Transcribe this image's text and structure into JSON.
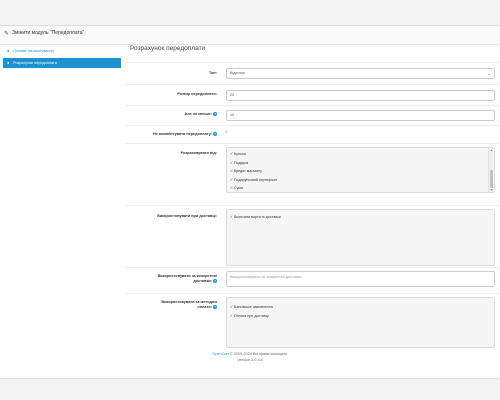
{
  "panel": {
    "title": "Змінити модуль \"Передоплата\""
  },
  "tabs": [
    {
      "label": "Основні налаштування",
      "icon": "circle-icon"
    },
    {
      "label": "Розрахунок передоплати",
      "icon": "circle-icon"
    }
  ],
  "content": {
    "title": "Розрахунок передоплати"
  },
  "fields": {
    "type": {
      "label": "Тип:",
      "value": "Відсоток"
    },
    "amount": {
      "label": "Розмір передоплати:",
      "value": "20"
    },
    "min": {
      "label": "Але не менше:",
      "value": "10"
    },
    "no_compensate": {
      "label": "Не компенсувати передоплату:",
      "checked": true
    },
    "calc_from": {
      "label": "Розраховувати від:",
      "items": [
        "Купони",
        "Подарок",
        "Кредит магазину",
        "Подарунковий сертифікат",
        "Сума"
      ]
    },
    "use_shipping": {
      "label": "Використовувати при доставці:",
      "items": [
        "Включати вартість доставки"
      ]
    },
    "specific_shipping": {
      "label": "Використовувати за конкретної доставки:",
      "placeholder": "Використовувати за конкретної доставки"
    },
    "payment_method": {
      "label": "Використовувати за методом оплати:",
      "items": [
        "Банківське замовлення",
        "Оплата при доставці"
      ]
    }
  },
  "footer": {
    "brand": "OpenCart",
    "copyright": " © 2009-2024 Всі права захищені.",
    "version": "Version 3.0.3.8"
  }
}
